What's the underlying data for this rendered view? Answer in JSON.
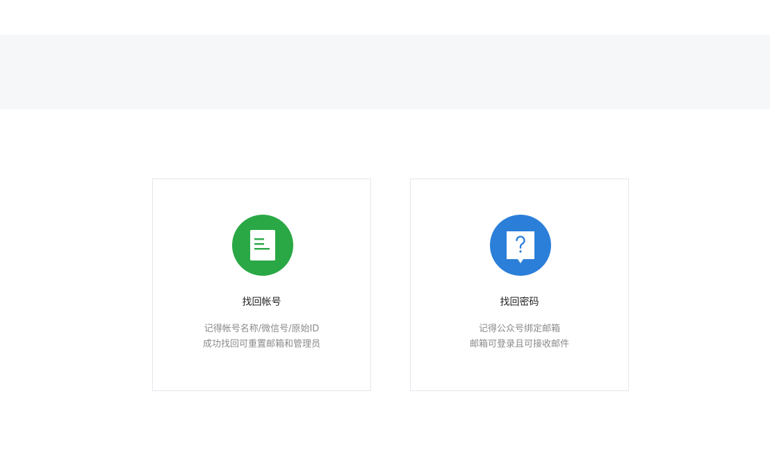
{
  "cards": [
    {
      "title": "找回帐号",
      "desc_line1": "记得帐号名称/微信号/原始ID",
      "desc_line2": "成功找回可重置邮箱和管理员",
      "icon": "document-icon",
      "color": "#2aa845"
    },
    {
      "title": "找回密码",
      "desc_line1": "记得公众号绑定邮箱",
      "desc_line2": "邮箱可登录且可接收邮件",
      "icon": "question-bubble-icon",
      "color": "#2b7fd9"
    }
  ]
}
